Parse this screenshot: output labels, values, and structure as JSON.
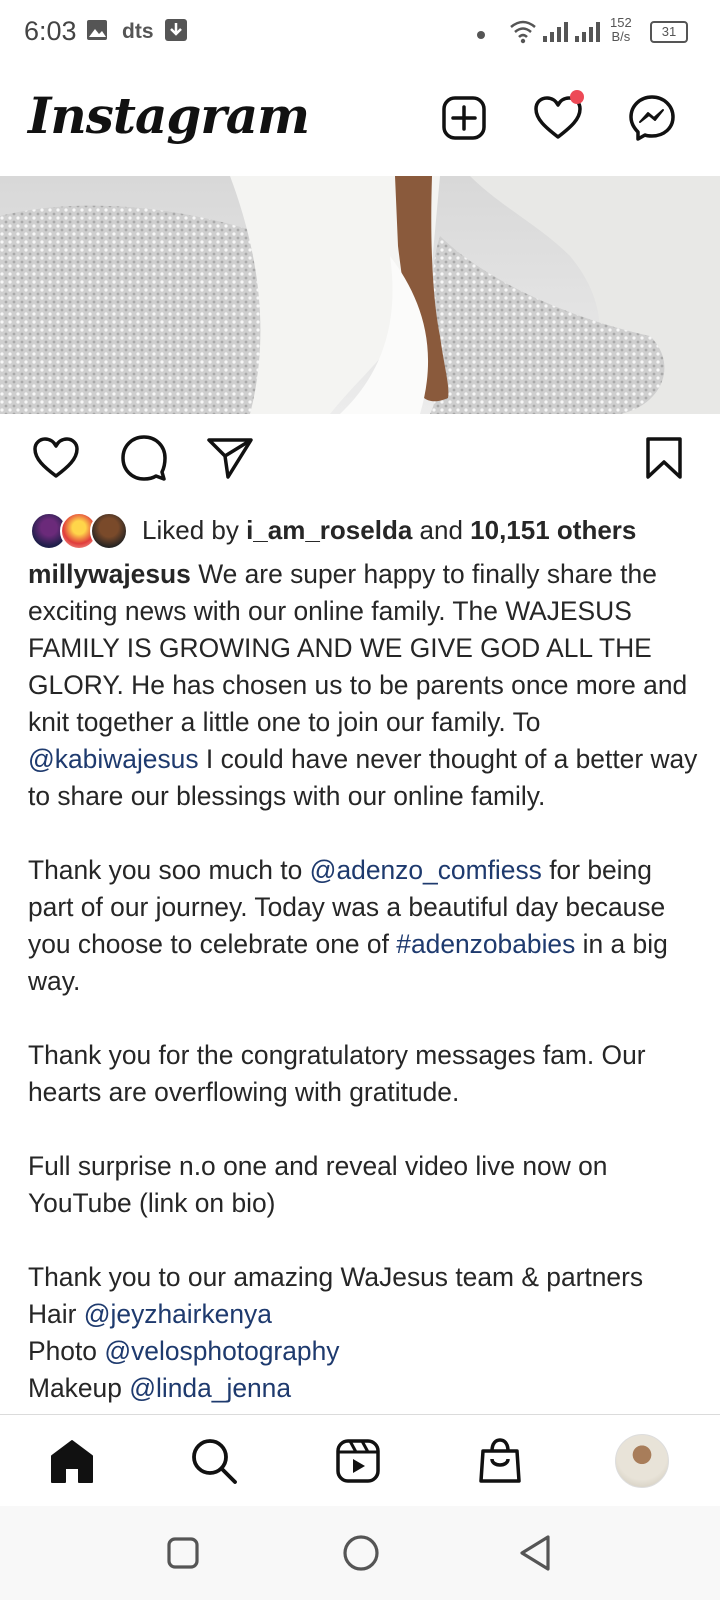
{
  "status_bar": {
    "time": "6:03",
    "carrier_label": "dts",
    "net_speed_value": "152",
    "net_speed_unit": "B/s",
    "battery": "31"
  },
  "top_bar": {
    "app_title": "Instagram",
    "notification_dot_color": "#ed4956"
  },
  "post": {
    "liked_by_prefix": "Liked by",
    "liked_by_user": "i_am_roselda",
    "liked_by_and": "and",
    "liked_by_others": "10,151 others",
    "author": "millywajesus",
    "caption": {
      "p1_text_a": "We are super happy to finally share the exciting news with our online family. The WAJESUS FAMILY IS GROWING AND WE GIVE GOD ALL THE GLORY. He has chosen us to be parents once more and knit together a little one to join our family. To",
      "p1_mention": "@kabiwajesus",
      "p1_text_b": "I could have never thought of a better way to share our blessings with our online family.",
      "p2_text_a": "Thank you soo much to",
      "p2_mention": "@adenzo_comfiess",
      "p2_text_b": "for being part of our journey. Today was a beautiful day because you choose to celebrate one of",
      "p2_hashtag": "#adenzobabies",
      "p2_text_c": "in a big way.",
      "p3_text": "Thank you for the congratulatory messages fam. Our hearts are overflowing with gratitude.",
      "p4_text": "Full surprise n.o one  and reveal video live now on YouTube (link on bio)",
      "p5_text": "Thank you to our amazing WaJesus team & partners",
      "credit_hair_label": "Hair",
      "credit_hair_mention": "@jeyzhairkenya",
      "credit_photo_label": "Photo",
      "credit_photo_mention": "@velosphotography",
      "credit_makeup_label": "Makeup",
      "credit_makeup_mention": "@linda_jenna"
    }
  },
  "icons": {
    "top_bar": [
      "new-post-icon",
      "heart-icon",
      "messenger-icon"
    ],
    "post_actions": [
      "like-icon",
      "comment-icon",
      "share-icon",
      "save-icon"
    ],
    "bottom_nav": [
      "home-icon",
      "search-icon",
      "reels-icon",
      "shop-icon",
      "profile-avatar"
    ],
    "system_nav": [
      "recents-icon",
      "home-circle-icon",
      "back-icon"
    ]
  },
  "colors": {
    "text": "#262626",
    "mention": "#1e3a6e",
    "background": "#ffffff"
  }
}
